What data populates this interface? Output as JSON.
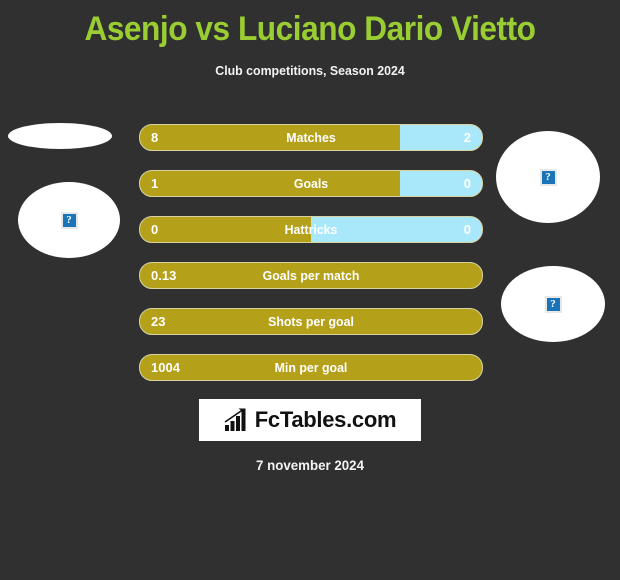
{
  "header": {
    "title": "Asenjo vs Luciano Dario Vietto",
    "subtitle": "Club competitions, Season 2024"
  },
  "colors": {
    "background": "#303030",
    "title": "#9ACD32",
    "home_bar": "#B5A019",
    "away_bar": "#A9E8FA",
    "text": "#FFFFFF",
    "logo_background": "#FFFFFF",
    "logo_text": "#111111"
  },
  "placeholders": {
    "left_flag": "broken-image-icon",
    "left_photo": "broken-image-icon",
    "right_photo": "broken-image-icon",
    "right_flag": "broken-image-icon",
    "broken_glyph": "?"
  },
  "stats": [
    {
      "label": "Matches",
      "home": "8",
      "away": "2",
      "home_pct": 76,
      "show_away": true
    },
    {
      "label": "Goals",
      "home": "1",
      "away": "0",
      "home_pct": 76,
      "show_away": true
    },
    {
      "label": "Hattricks",
      "home": "0",
      "away": "0",
      "home_pct": 50,
      "show_away": true
    },
    {
      "label": "Goals per match",
      "home": "0.13",
      "away": "",
      "home_pct": 100,
      "show_away": false
    },
    {
      "label": "Shots per goal",
      "home": "23",
      "away": "",
      "home_pct": 100,
      "show_away": false
    },
    {
      "label": "Min per goal",
      "home": "1004",
      "away": "",
      "home_pct": 100,
      "show_away": false
    }
  ],
  "logo": {
    "text": "FcTables.com",
    "icon": "bar-chart-growth-icon"
  },
  "footer": {
    "date": "7 november 2024"
  }
}
